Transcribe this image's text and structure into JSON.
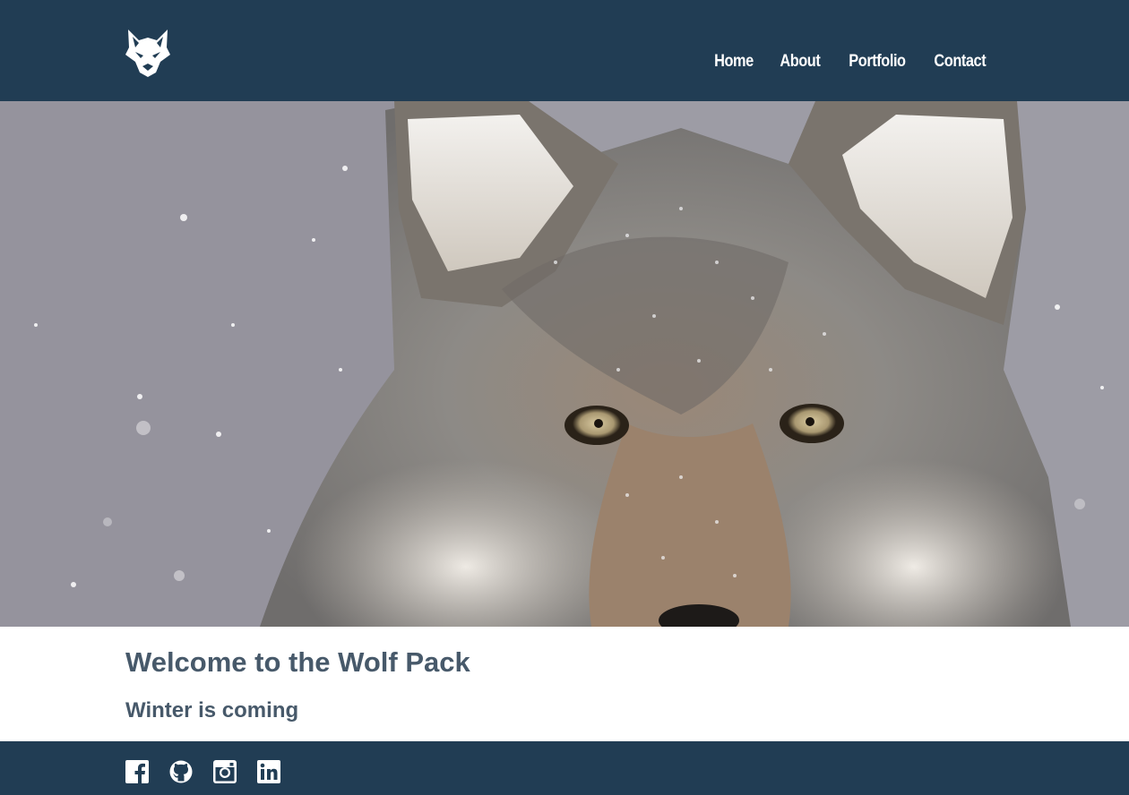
{
  "header": {
    "logo_icon": "wolf-head-icon",
    "nav": [
      {
        "label": "Home"
      },
      {
        "label": "About"
      },
      {
        "label": "Portfolio"
      },
      {
        "label": "Contact"
      }
    ]
  },
  "hero": {
    "image_subject": "wolf-face-in-snow"
  },
  "content": {
    "headline": "Welcome to the Wolf Pack",
    "subheadline": "Winter is coming"
  },
  "footer": {
    "social": [
      {
        "icon": "facebook-icon"
      },
      {
        "icon": "github-icon"
      },
      {
        "icon": "instagram-icon"
      },
      {
        "icon": "linkedin-icon"
      }
    ]
  },
  "colors": {
    "header_bg": "#213d54",
    "text_heading": "#47596a",
    "nav_text": "#ffffff"
  }
}
